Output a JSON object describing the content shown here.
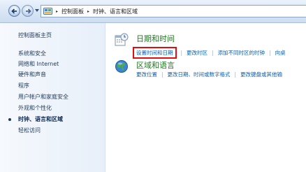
{
  "address_bar": {
    "breadcrumbs": [
      "控制面板",
      "时钟、语言和区域"
    ],
    "separator": "▸"
  },
  "sidebar": {
    "items": [
      {
        "label": "控制面板主页",
        "current": false
      },
      {
        "label": "系统和安全",
        "current": false
      },
      {
        "label": "网络和 Internet",
        "current": false
      },
      {
        "label": "硬件和声音",
        "current": false
      },
      {
        "label": "程序",
        "current": false
      },
      {
        "label": "用户帐户和家庭安全",
        "current": false
      },
      {
        "label": "外观和个性化",
        "current": false
      },
      {
        "label": "时钟、语言和区域",
        "current": true
      },
      {
        "label": "轻松访问",
        "current": false
      }
    ]
  },
  "categories": [
    {
      "title": "日期和时间",
      "icon": "calendar-clock-icon",
      "tasks": [
        "设置时间和日期",
        "更改时区",
        "添加不同时区的时钟",
        "向桌"
      ]
    },
    {
      "title": "区域和语言",
      "icon": "globe-icon",
      "tasks": [
        "更改位置",
        "更改日期、时间或数字格式",
        "更改键盘或其他输"
      ]
    }
  ],
  "colors": {
    "link": "#0a5fb4",
    "category_title": "#1f7a1f",
    "highlight": "#e01010",
    "sidebar_text": "#1e395b"
  }
}
